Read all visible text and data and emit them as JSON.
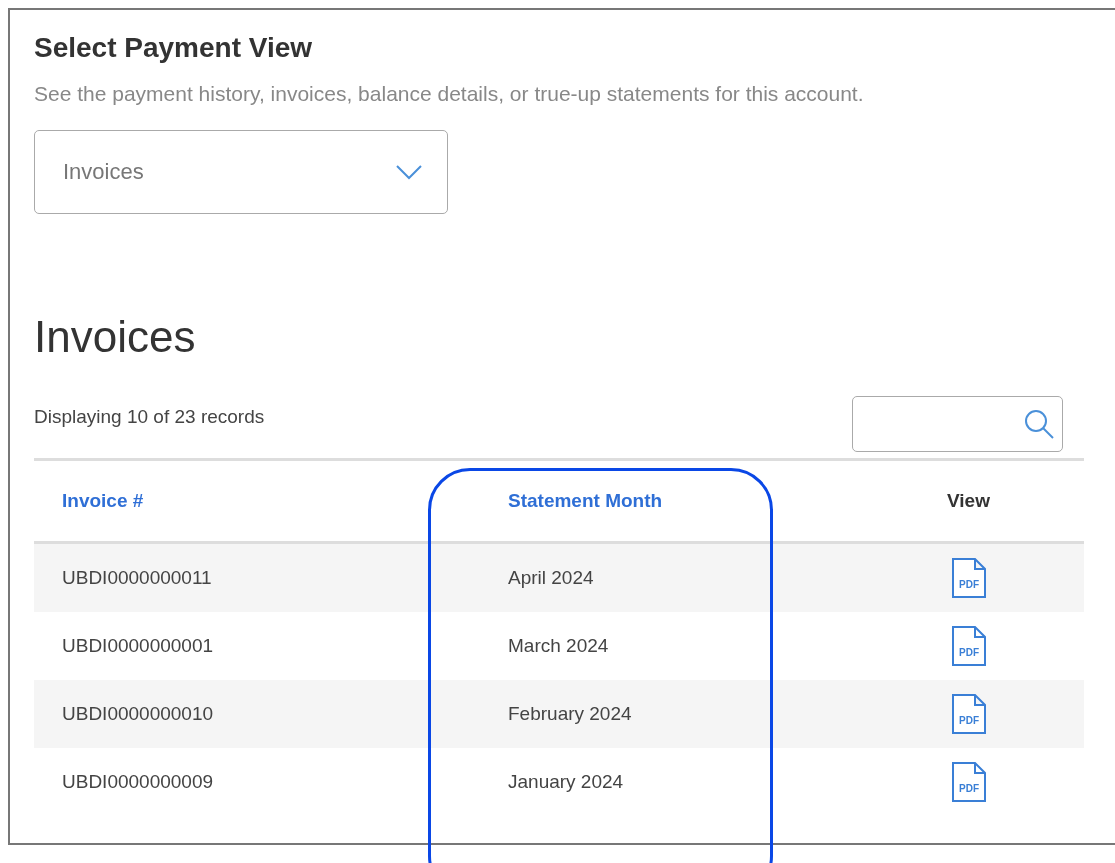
{
  "heading": "Select Payment View",
  "subtitle": "See the payment history, invoices, balance details, or true-up statements for this account.",
  "view_select": {
    "value": "Invoices"
  },
  "section_title": "Invoices",
  "record_count": "Displaying 10 of 23 records",
  "table": {
    "columns": [
      {
        "label": "Invoice #",
        "sortable": true
      },
      {
        "label": "Statement Month",
        "sortable": true
      },
      {
        "label": "View",
        "sortable": false
      }
    ],
    "rows": [
      {
        "invoice": "UBDI0000000011",
        "month": "April 2024",
        "file_label": "PDF"
      },
      {
        "invoice": "UBDI0000000001",
        "month": "March 2024",
        "file_label": "PDF"
      },
      {
        "invoice": "UBDI0000000010",
        "month": "February 2024",
        "file_label": "PDF"
      },
      {
        "invoice": "UBDI0000000009",
        "month": "January 2024",
        "file_label": "PDF"
      }
    ]
  },
  "highlight": {
    "visible": true
  }
}
